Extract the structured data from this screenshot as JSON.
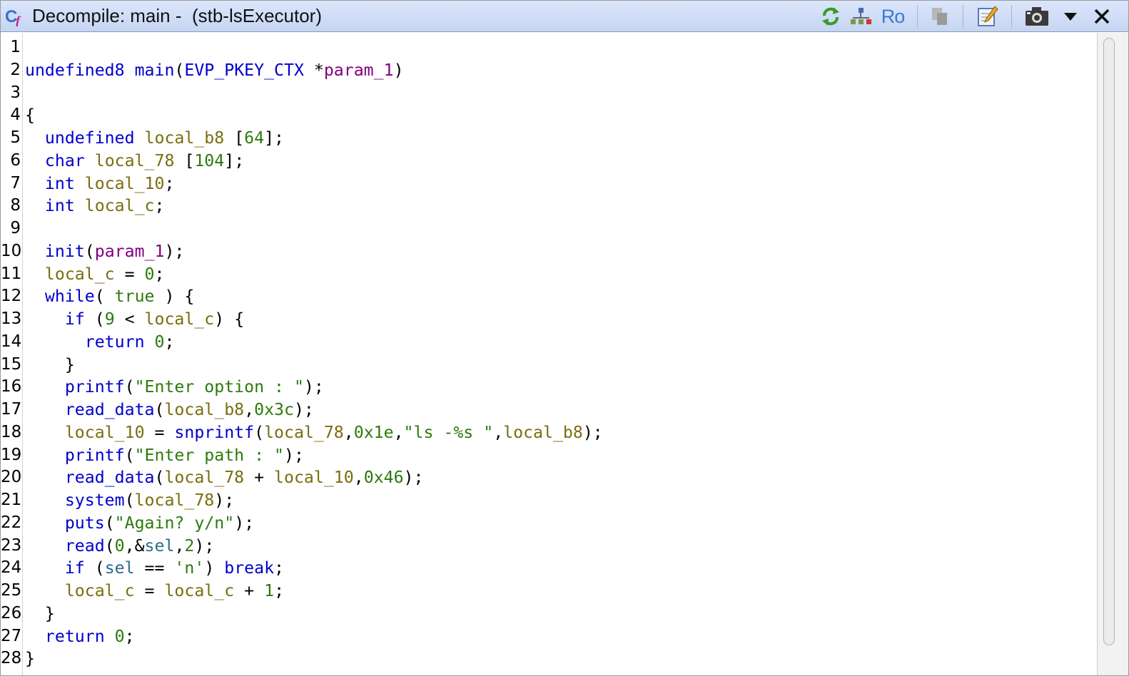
{
  "window": {
    "title": "Decompile: main -  (stb-lsExecutor)",
    "app_icon": "decompiler-cf-icon"
  },
  "toolbar": {
    "buttons": [
      {
        "name": "refresh-icon",
        "tooltip": ""
      },
      {
        "name": "graph-icon",
        "tooltip": ""
      },
      {
        "name": "read-only-icon",
        "label": "Ro"
      },
      {
        "name": "copy-icon"
      },
      {
        "name": "edit-icon"
      },
      {
        "name": "snapshot-icon"
      },
      {
        "name": "menu-chevron-down-icon"
      },
      {
        "name": "close-icon"
      }
    ]
  },
  "colors": {
    "keyword": "#0000cc",
    "function": "#0000cc",
    "variable": "#7a6d0f",
    "param": "#800080",
    "constant": "#2d7a0c",
    "string": "#2d7a0c",
    "global": "#2c6a8c",
    "plain": "#000000"
  },
  "code_lines": [
    {
      "n": "1",
      "tokens": []
    },
    {
      "n": "2",
      "tokens": [
        [
          "type",
          "undefined8"
        ],
        [
          "p",
          " "
        ],
        [
          "func",
          "main"
        ],
        [
          "p",
          "("
        ],
        [
          "type",
          "EVP_PKEY_CTX"
        ],
        [
          "p",
          " *"
        ],
        [
          "param",
          "param_1"
        ],
        [
          "p",
          ")"
        ]
      ]
    },
    {
      "n": "3",
      "tokens": []
    },
    {
      "n": "4",
      "tokens": [
        [
          "p",
          "{"
        ]
      ]
    },
    {
      "n": "5",
      "tokens": [
        [
          "p",
          "  "
        ],
        [
          "type",
          "undefined"
        ],
        [
          "p",
          " "
        ],
        [
          "var",
          "local_b8"
        ],
        [
          "p",
          " ["
        ],
        [
          "const",
          "64"
        ],
        [
          "p",
          "];"
        ]
      ]
    },
    {
      "n": "6",
      "tokens": [
        [
          "p",
          "  "
        ],
        [
          "type",
          "char"
        ],
        [
          "p",
          " "
        ],
        [
          "var",
          "local_78"
        ],
        [
          "p",
          " ["
        ],
        [
          "const",
          "104"
        ],
        [
          "p",
          "];"
        ]
      ]
    },
    {
      "n": "7",
      "tokens": [
        [
          "p",
          "  "
        ],
        [
          "type",
          "int"
        ],
        [
          "p",
          " "
        ],
        [
          "var",
          "local_10"
        ],
        [
          "p",
          ";"
        ]
      ]
    },
    {
      "n": "8",
      "tokens": [
        [
          "p",
          "  "
        ],
        [
          "type",
          "int"
        ],
        [
          "p",
          " "
        ],
        [
          "var",
          "local_c"
        ],
        [
          "p",
          ";"
        ]
      ]
    },
    {
      "n": "9",
      "tokens": []
    },
    {
      "n": "10",
      "tokens": [
        [
          "p",
          "  "
        ],
        [
          "func",
          "init"
        ],
        [
          "p",
          "("
        ],
        [
          "param",
          "param_1"
        ],
        [
          "p",
          ");"
        ]
      ]
    },
    {
      "n": "11",
      "tokens": [
        [
          "p",
          "  "
        ],
        [
          "var",
          "local_c"
        ],
        [
          "p",
          " = "
        ],
        [
          "const",
          "0"
        ],
        [
          "p",
          ";"
        ]
      ]
    },
    {
      "n": "12",
      "tokens": [
        [
          "p",
          "  "
        ],
        [
          "kw",
          "while"
        ],
        [
          "p",
          "( "
        ],
        [
          "const",
          "true"
        ],
        [
          "p",
          " ) {"
        ]
      ]
    },
    {
      "n": "13",
      "tokens": [
        [
          "p",
          "    "
        ],
        [
          "kw",
          "if"
        ],
        [
          "p",
          " ("
        ],
        [
          "const",
          "9"
        ],
        [
          "p",
          " < "
        ],
        [
          "var",
          "local_c"
        ],
        [
          "p",
          ") {"
        ]
      ]
    },
    {
      "n": "14",
      "tokens": [
        [
          "p",
          "      "
        ],
        [
          "kw",
          "return"
        ],
        [
          "p",
          " "
        ],
        [
          "const",
          "0"
        ],
        [
          "p",
          ";"
        ]
      ]
    },
    {
      "n": "15",
      "tokens": [
        [
          "p",
          "    }"
        ]
      ]
    },
    {
      "n": "16",
      "tokens": [
        [
          "p",
          "    "
        ],
        [
          "func",
          "printf"
        ],
        [
          "p",
          "("
        ],
        [
          "str",
          "\"Enter option : \""
        ],
        [
          "p",
          ");"
        ]
      ]
    },
    {
      "n": "17",
      "tokens": [
        [
          "p",
          "    "
        ],
        [
          "func",
          "read_data"
        ],
        [
          "p",
          "("
        ],
        [
          "var",
          "local_b8"
        ],
        [
          "p",
          ","
        ],
        [
          "const",
          "0x3c"
        ],
        [
          "p",
          ");"
        ]
      ]
    },
    {
      "n": "18",
      "tokens": [
        [
          "p",
          "    "
        ],
        [
          "var",
          "local_10"
        ],
        [
          "p",
          " = "
        ],
        [
          "func",
          "snprintf"
        ],
        [
          "p",
          "("
        ],
        [
          "var",
          "local_78"
        ],
        [
          "p",
          ","
        ],
        [
          "const",
          "0x1e"
        ],
        [
          "p",
          ","
        ],
        [
          "str",
          "\"ls -%s \""
        ],
        [
          "p",
          ","
        ],
        [
          "var",
          "local_b8"
        ],
        [
          "p",
          ");"
        ]
      ]
    },
    {
      "n": "19",
      "tokens": [
        [
          "p",
          "    "
        ],
        [
          "func",
          "printf"
        ],
        [
          "p",
          "("
        ],
        [
          "str",
          "\"Enter path : \""
        ],
        [
          "p",
          ");"
        ]
      ]
    },
    {
      "n": "20",
      "tokens": [
        [
          "p",
          "    "
        ],
        [
          "func",
          "read_data"
        ],
        [
          "p",
          "("
        ],
        [
          "var",
          "local_78"
        ],
        [
          "p",
          " + "
        ],
        [
          "var",
          "local_10"
        ],
        [
          "p",
          ","
        ],
        [
          "const",
          "0x46"
        ],
        [
          "p",
          ");"
        ]
      ]
    },
    {
      "n": "21",
      "tokens": [
        [
          "p",
          "    "
        ],
        [
          "func",
          "system"
        ],
        [
          "p",
          "("
        ],
        [
          "var",
          "local_78"
        ],
        [
          "p",
          ");"
        ]
      ]
    },
    {
      "n": "22",
      "tokens": [
        [
          "p",
          "    "
        ],
        [
          "func",
          "puts"
        ],
        [
          "p",
          "("
        ],
        [
          "str",
          "\"Again? y/n\""
        ],
        [
          "p",
          ");"
        ]
      ]
    },
    {
      "n": "23",
      "tokens": [
        [
          "p",
          "    "
        ],
        [
          "func",
          "read"
        ],
        [
          "p",
          "("
        ],
        [
          "const",
          "0"
        ],
        [
          "p",
          ",&"
        ],
        [
          "global",
          "sel"
        ],
        [
          "p",
          ","
        ],
        [
          "const",
          "2"
        ],
        [
          "p",
          ");"
        ]
      ]
    },
    {
      "n": "24",
      "tokens": [
        [
          "p",
          "    "
        ],
        [
          "kw",
          "if"
        ],
        [
          "p",
          " ("
        ],
        [
          "global",
          "sel"
        ],
        [
          "p",
          " == "
        ],
        [
          "str",
          "'n'"
        ],
        [
          "p",
          ") "
        ],
        [
          "kw",
          "break"
        ],
        [
          "p",
          ";"
        ]
      ]
    },
    {
      "n": "25",
      "tokens": [
        [
          "p",
          "    "
        ],
        [
          "var",
          "local_c"
        ],
        [
          "p",
          " = "
        ],
        [
          "var",
          "local_c"
        ],
        [
          "p",
          " + "
        ],
        [
          "const",
          "1"
        ],
        [
          "p",
          ";"
        ]
      ]
    },
    {
      "n": "26",
      "tokens": [
        [
          "p",
          "  }"
        ]
      ]
    },
    {
      "n": "27",
      "tokens": [
        [
          "p",
          "  "
        ],
        [
          "kw",
          "return"
        ],
        [
          "p",
          " "
        ],
        [
          "const",
          "0"
        ],
        [
          "p",
          ";"
        ]
      ]
    },
    {
      "n": "28",
      "tokens": [
        [
          "p",
          "}"
        ]
      ]
    }
  ]
}
